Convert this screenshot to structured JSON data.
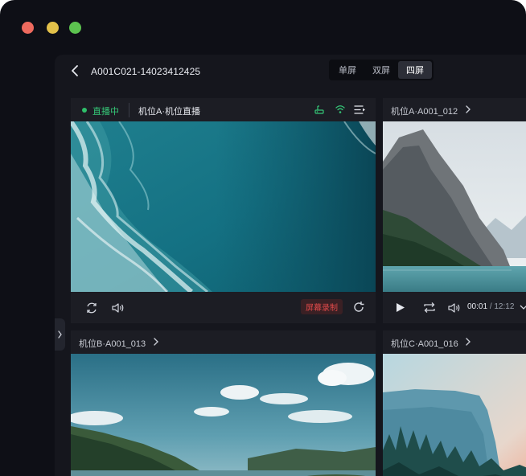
{
  "window": {
    "title": "A001C021-14023412425"
  },
  "layout_switch": {
    "options": [
      "单屏",
      "双屏",
      "四屏"
    ],
    "selected": "四屏"
  },
  "tiles": {
    "a": {
      "status": "直播中",
      "name": "机位A·机位直播",
      "record_label": "屏幕录制"
    },
    "b": {
      "name": "机位A·A001_012",
      "time_current": "00:01",
      "time_separator": "/",
      "time_total": "12:12"
    },
    "c": {
      "name": "机位B·A001_013"
    },
    "d": {
      "name": "机位C·A001_016"
    }
  },
  "colors": {
    "live_green": "#35c777",
    "record_red": "#e14a4a",
    "background": "#0e0f16",
    "panel": "#15161d",
    "tile": "#1c1d24"
  },
  "icons": [
    "back-icon",
    "network-icon",
    "wifi-icon",
    "playlist-icon",
    "chevron-right-icon",
    "refresh-icon",
    "volume-icon",
    "reload-icon",
    "play-icon",
    "loop-icon",
    "chevron-down-icon",
    "side-expand-icon"
  ]
}
